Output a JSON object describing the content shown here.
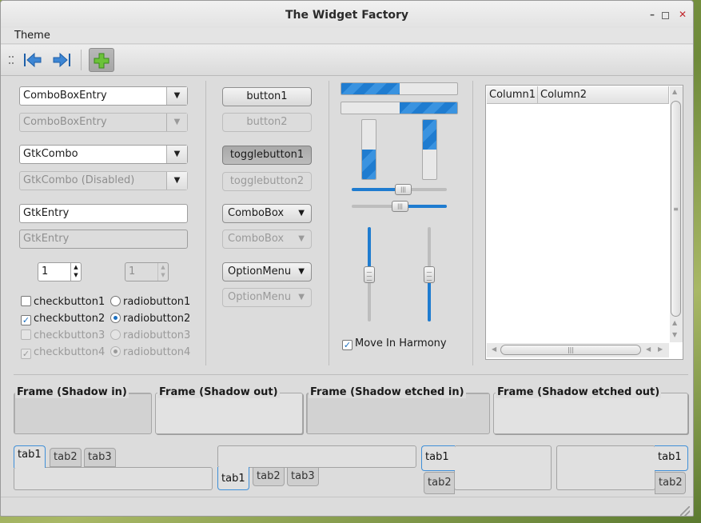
{
  "window": {
    "title": "The Widget Factory"
  },
  "menubar": {
    "theme": "Theme"
  },
  "toolbar": {
    "back": "go-first-icon",
    "forward": "go-last-icon",
    "add": "add-icon"
  },
  "col1": {
    "combo_entry": "ComboBoxEntry",
    "combo_entry_dis": "ComboBoxEntry",
    "gtkcombo": "GtkCombo",
    "gtkcombo_dis": "GtkCombo (Disabled)",
    "entry": "GtkEntry",
    "entry_dis": "GtkEntry",
    "spin": "1",
    "spin_dis": "1",
    "check1": "checkbutton1",
    "check2": "checkbutton2",
    "check3": "checkbutton3",
    "check4": "checkbutton4",
    "radio1": "radiobutton1",
    "radio2": "radiobutton2",
    "radio3": "radiobutton3",
    "radio4": "radiobutton4"
  },
  "col2": {
    "button1": "button1",
    "button2": "button2",
    "toggle1": "togglebutton1",
    "toggle2": "togglebutton2",
    "combobox": "ComboBox",
    "combobox_dis": "ComboBox",
    "optionmenu": "OptionMenu",
    "optionmenu_dis": "OptionMenu"
  },
  "col3": {
    "progress_h1": 0.5,
    "progress_h2": 0.5,
    "progress_v1": 0.5,
    "progress_v2": 0.5,
    "harmony": "Move In Harmony"
  },
  "tree": {
    "columns": [
      "Column1",
      "Column2"
    ]
  },
  "frames": [
    "Frame (Shadow in)",
    "Frame (Shadow out)",
    "Frame (Shadow etched in)",
    "Frame (Shadow etched out)"
  ],
  "notebooks": {
    "tabs": [
      "tab1",
      "tab2",
      "tab3"
    ]
  },
  "colors": {
    "accent": "#1f7cd0"
  }
}
